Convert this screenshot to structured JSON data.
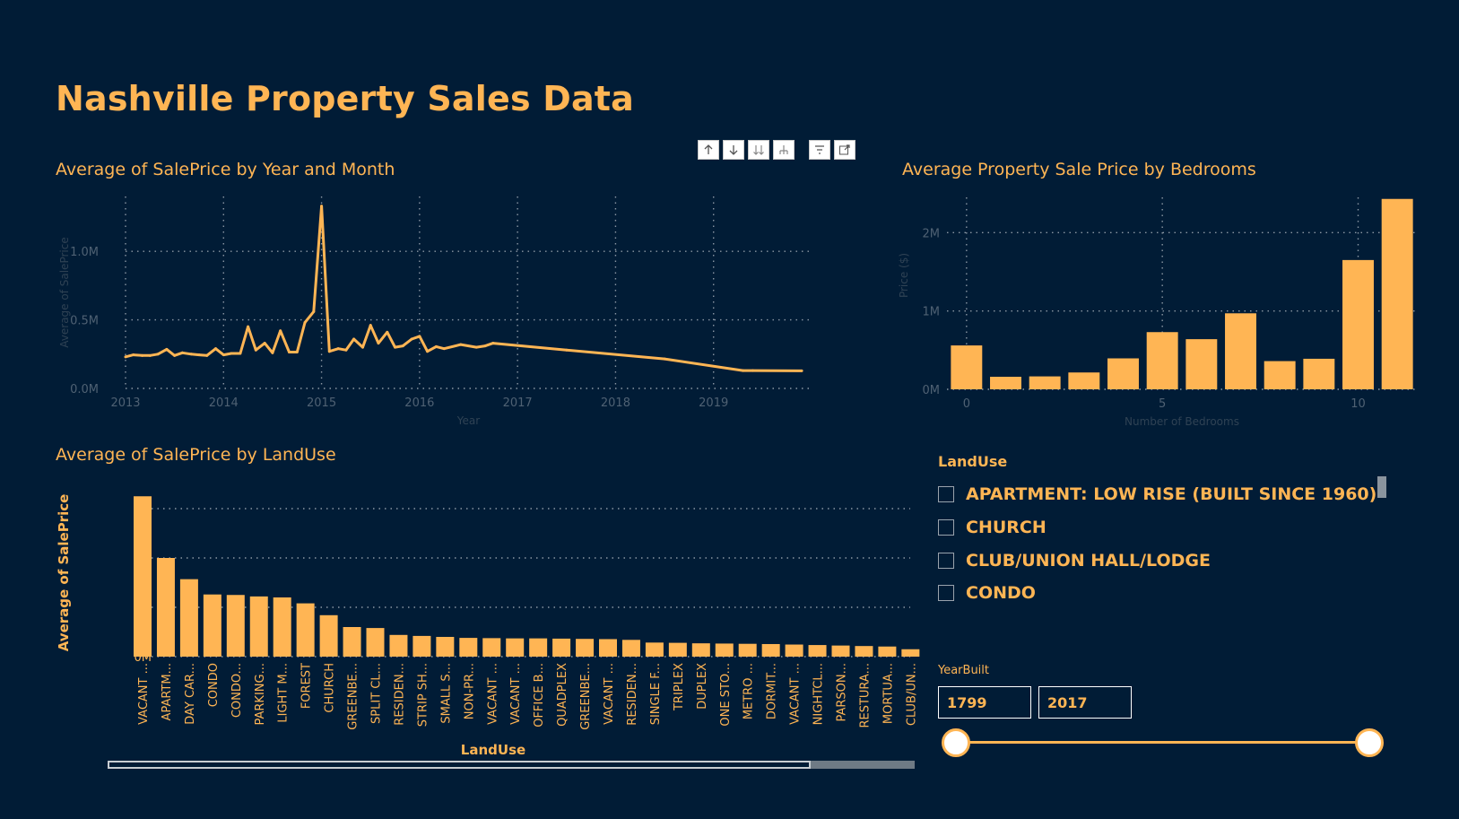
{
  "page": {
    "title": "Nashville Property Sales Data",
    "background": "#011c36",
    "accent": "#ffb554"
  },
  "toolbar": {
    "icons": [
      "arrow-up-icon",
      "arrow-down-icon",
      "double-arrow-down-icon",
      "drill-hierarchy-icon",
      "filter-icon",
      "focus-mode-icon"
    ]
  },
  "chart_data": [
    {
      "id": "line-year-month",
      "type": "line",
      "title": "Average of SalePrice by Year and Month",
      "xlabel": "Year",
      "ylabel": "Average of SalePrice",
      "x_ticks": [
        "2013",
        "2014",
        "2015",
        "2016",
        "2017",
        "2018",
        "2019"
      ],
      "y_ticks": [
        "0.0M",
        "0.5M",
        "1.0M"
      ],
      "xlim": [
        2013.0,
        2020.0
      ],
      "ylim": [
        0,
        1400000
      ],
      "grid": true,
      "points": [
        [
          2013.0,
          230000
        ],
        [
          2013.08,
          245000
        ],
        [
          2013.17,
          240000
        ],
        [
          2013.25,
          240000
        ],
        [
          2013.33,
          250000
        ],
        [
          2013.42,
          285000
        ],
        [
          2013.5,
          240000
        ],
        [
          2013.58,
          260000
        ],
        [
          2013.67,
          250000
        ],
        [
          2013.75,
          245000
        ],
        [
          2013.83,
          240000
        ],
        [
          2013.92,
          290000
        ],
        [
          2014.0,
          245000
        ],
        [
          2014.08,
          255000
        ],
        [
          2014.17,
          255000
        ],
        [
          2014.25,
          450000
        ],
        [
          2014.33,
          280000
        ],
        [
          2014.42,
          330000
        ],
        [
          2014.5,
          260000
        ],
        [
          2014.58,
          420000
        ],
        [
          2014.67,
          265000
        ],
        [
          2014.75,
          265000
        ],
        [
          2014.83,
          480000
        ],
        [
          2014.92,
          560000
        ],
        [
          2015.0,
          1330000
        ],
        [
          2015.08,
          270000
        ],
        [
          2015.17,
          290000
        ],
        [
          2015.25,
          280000
        ],
        [
          2015.33,
          360000
        ],
        [
          2015.42,
          300000
        ],
        [
          2015.5,
          460000
        ],
        [
          2015.58,
          330000
        ],
        [
          2015.67,
          410000
        ],
        [
          2015.75,
          300000
        ],
        [
          2015.83,
          310000
        ],
        [
          2015.92,
          360000
        ],
        [
          2016.0,
          380000
        ],
        [
          2016.08,
          270000
        ],
        [
          2016.17,
          305000
        ],
        [
          2016.25,
          290000
        ],
        [
          2016.42,
          320000
        ],
        [
          2016.58,
          300000
        ],
        [
          2016.67,
          310000
        ],
        [
          2016.75,
          330000
        ],
        [
          2017.5,
          280000
        ],
        [
          2018.5,
          215000
        ],
        [
          2019.3,
          130000
        ],
        [
          2019.4,
          130000
        ],
        [
          2019.9,
          128000
        ]
      ]
    },
    {
      "id": "bar-bedrooms",
      "type": "bar",
      "title": "Average Property Sale Price by Bedrooms",
      "xlabel": "Number of Bedrooms",
      "ylabel": "Price ($)",
      "x_ticks": [
        "0",
        "5",
        "10"
      ],
      "y_ticks": [
        "0M",
        "1M",
        "2M"
      ],
      "xlim": [
        -0.5,
        11.5
      ],
      "ylim": [
        0,
        2450000
      ],
      "grid": true,
      "categories": [
        0,
        1,
        2,
        3,
        4,
        5,
        6,
        7,
        8,
        9,
        10,
        11
      ],
      "values": [
        560000,
        160000,
        165000,
        215000,
        395000,
        730000,
        640000,
        970000,
        360000,
        390000,
        1650000,
        2430000
      ]
    },
    {
      "id": "bar-landuse",
      "type": "bar",
      "title": "Average of SalePrice by LandUse",
      "xlabel": "LandUse",
      "ylabel": "Average of SalePrice",
      "y_ticks": [
        "0M",
        "1M",
        "2M",
        "3M"
      ],
      "ylim": [
        0,
        3400000
      ],
      "grid": true,
      "categories": [
        "VACANT ...",
        "APARTM...",
        "DAY CAR...",
        "CONDO",
        "CONDO...",
        "PARKING...",
        "LIGHT M...",
        "FOREST",
        "CHURCH",
        "GREENBE...",
        "SPLIT CL...",
        "RESIDEN...",
        "STRIP SH...",
        "SMALL S...",
        "NON-PR...",
        "VACANT ...",
        "VACANT ...",
        "OFFICE B...",
        "QUADPLEX",
        "GREENBE...",
        "VACANT ...",
        "RESIDEN...",
        "SINGLE F...",
        "TRIPLEX",
        "DUPLEX",
        "ONE STO...",
        "METRO ...",
        "DORMIT...",
        "VACANT ...",
        "NIGHTCL...",
        "PARSON...",
        "RESTURA...",
        "MORTUA...",
        "CLUB/UN..."
      ],
      "values": [
        3250000,
        2000000,
        1570000,
        1260000,
        1250000,
        1220000,
        1200000,
        1080000,
        840000,
        600000,
        580000,
        440000,
        420000,
        400000,
        380000,
        375000,
        370000,
        370000,
        365000,
        360000,
        355000,
        340000,
        285000,
        280000,
        270000,
        265000,
        260000,
        255000,
        245000,
        235000,
        225000,
        215000,
        205000,
        150000
      ]
    }
  ],
  "landuse_slicer": {
    "header": "LandUse",
    "items": [
      "APARTMENT: LOW RISE (BUILT SINCE 1960)",
      "CHURCH",
      "CLUB/UNION HALL/LODGE",
      "CONDO"
    ]
  },
  "yearbuilt_slicer": {
    "header": "YearBuilt",
    "min_value": "1799",
    "max_value": "2017"
  }
}
